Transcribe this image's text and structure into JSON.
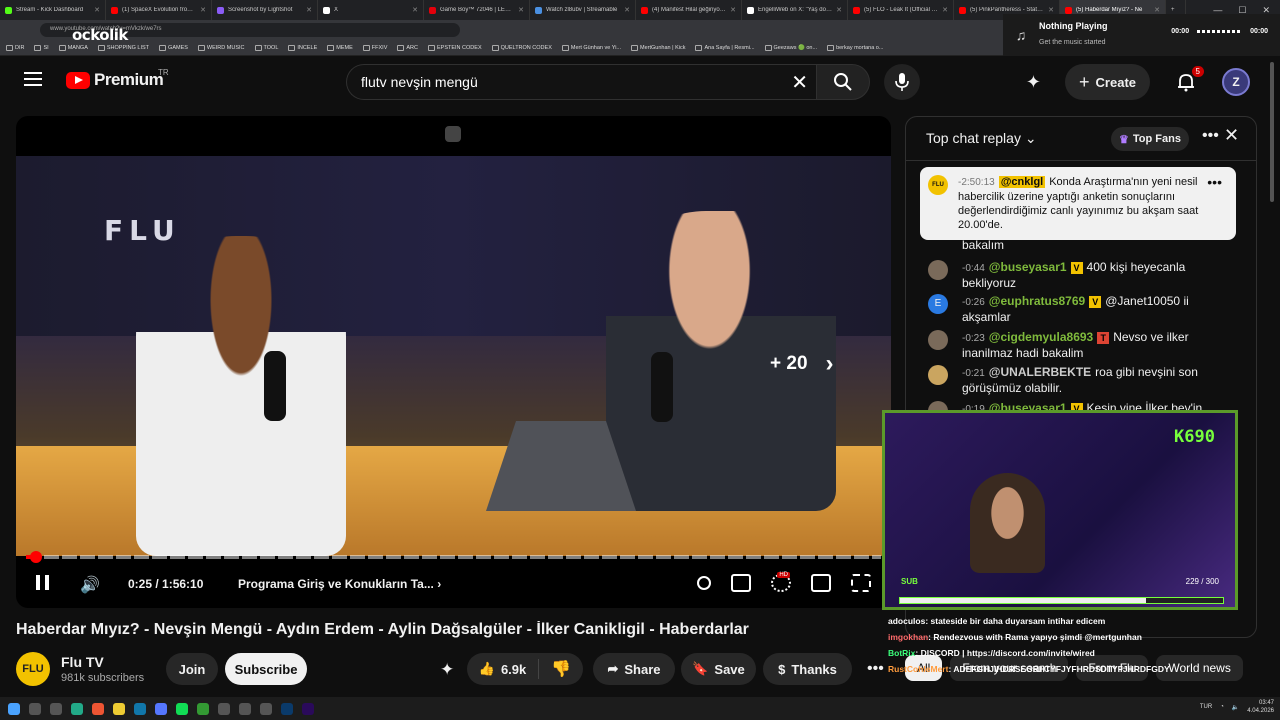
{
  "browser": {
    "tabs": [
      {
        "title": "Stream - Kick Dashboard",
        "color": "#53fc18"
      },
      {
        "title": "(1) SpaceX Evolution from 20",
        "color": "#ff0000"
      },
      {
        "title": "Screenshot by Lightshot",
        "color": "#8b5cf6"
      },
      {
        "title": "X",
        "color": "#ffffff"
      },
      {
        "title": "Game Boy™ 72046 | LEGO®",
        "color": "#e3000b"
      },
      {
        "title": "Watch zl8ubv | Streamable",
        "color": "#4a90e2"
      },
      {
        "title": "(4) Manifest Hilal geğiriyor (y",
        "color": "#ff0000"
      },
      {
        "title": "EngelliWeb on X: \"Yaş doğrula",
        "color": "#ffffff"
      },
      {
        "title": "(5) FLO - Leak It (Official Vide",
        "color": "#ff0000"
      },
      {
        "title": "(5) PinkPantheress - Stateside",
        "color": "#ff0000"
      },
      {
        "title": "(5) Haberdar Mıyız? - Ne",
        "color": "#ff0000",
        "active": true
      }
    ],
    "url": "www.youtube.com/watch?v=mVkzk/we7rs",
    "overlay_logo": "ockolik",
    "bookmarks": [
      "DIR",
      "SI",
      "MANGA",
      "SHOPPING LIST",
      "GAMES",
      "WEIRD MUSIC",
      "TOOL",
      "INCELE",
      "MEME",
      "FFXIV",
      "ARC",
      "EPSTEIN CODEX",
      "QUELTRON CODEX",
      "Mert Günhan ve Yi...",
      "MertGunhan | Kick",
      "Ana Sayfa | Resmi...",
      "Geezaws 🟢 on...",
      "berkay mortana o..."
    ],
    "now_playing": {
      "title": "Nothing Playing",
      "subtitle": "Get the music started",
      "t1": "00:00",
      "t2": "00:00"
    }
  },
  "header": {
    "logo_text": "Premium",
    "region": "TR",
    "search_query": "flutv nevşin mengü",
    "create_label": "Create",
    "notif_count": "5"
  },
  "player": {
    "time": "0:25 / 1:56:10",
    "chapter": "Programa Giriş ve Konukların Ta...",
    "skip_label": "+ 20",
    "hd_badge": "HD",
    "progress": 0.004,
    "scene_wall_text": "FLU"
  },
  "video": {
    "title": "Haberdar Mıyız? - Nevşin Mengü - Aydın Erdem - Aylin Dağsalgüler - İlker Canikligil - Haberdarlar",
    "channel": "Flu TV",
    "channel_avatar_text": "FLU",
    "subscribers": "981k subscribers",
    "join_label": "Join",
    "subscribe_label": "Subscribe",
    "likes": "6.9k",
    "share_label": "Share",
    "save_label": "Save",
    "thanks_label": "Thanks"
  },
  "chat": {
    "header": "Top chat replay",
    "top_fans": "Top Fans",
    "pinned": {
      "avatar": "FLU",
      "time": "-2:50:13",
      "user": "@cnklgl",
      "text": "Konda Araştırma'nın yeni nesil habercilik üzerine yaptığı anketin sonuçlarını değerlendirdiğimiz canlı yayınımız bu akşam saat 20.00'de."
    },
    "partial_prev": "bakalım",
    "messages": [
      {
        "time": "-0:44",
        "user": "@buseyasar1",
        "tag": "V",
        "text": "400 kişi heyecanla bekliyoruz"
      },
      {
        "time": "-0:26",
        "user": "@euphratus8769",
        "tag": "V",
        "text": "@Janet10050 ii akşamlar",
        "avatar_letter": "E"
      },
      {
        "time": "-0:23",
        "user": "@cigdemyula8693",
        "tag": "T",
        "text": "Nevso ve ilker inanilmaz hadi bakalim"
      },
      {
        "time": "-0:21",
        "user": "@UNALERBEKTE",
        "text": "roa gibi nevşini son görüşümüz olabilir."
      },
      {
        "time": "-0:19",
        "user": "@buseyasar1",
        "tag": "V",
        "text": "Kesin vine İlker bev'in"
      }
    ],
    "chips": [
      "All",
      "From your search",
      "From Flu",
      "World news"
    ]
  },
  "stream_overlay": {
    "count": "K690",
    "sub_label": "SUB",
    "sub_progress_text": "229 / 300",
    "sub_progress": 0.763,
    "lines": [
      {
        "user": "adoculos",
        "text": ": stateside bir daha duyarsam intihar edicem",
        "cls": "u1"
      },
      {
        "user": "imgokhan",
        "text": ": Rendezvous with Rama yapıyo şimdi @mertgunhan",
        "cls": "u2"
      },
      {
        "user": "BotRix",
        "text": ": DISCORD | https://discord.com/invite/wired",
        "cls": "u3"
      },
      {
        "user": "RustCohleMert",
        "text": ": ADEFGHJIHDRSEGRHTYFJYFHRDSDTYFJHRDFGDY",
        "cls": "u4"
      }
    ]
  },
  "taskbar": {
    "lang": "TUR",
    "time": "03:47",
    "date": "4.04.2026"
  }
}
